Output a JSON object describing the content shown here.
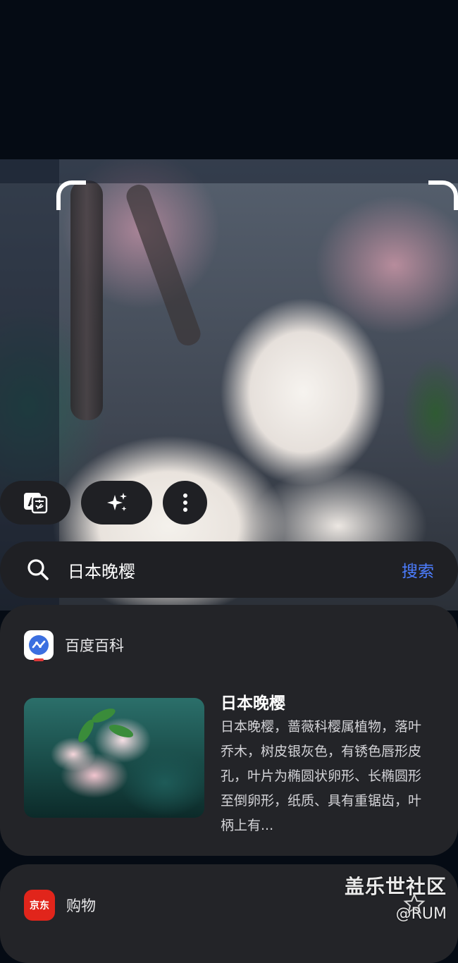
{
  "search": {
    "query": "日本晚樱",
    "action_label": "搜索"
  },
  "baike_card": {
    "source": "百度百科",
    "title": "日本晚樱",
    "description": "日本晚樱，蔷薇科樱属植物，落叶乔木，树皮银灰色，有锈色唇形皮孔，叶片为椭圆状卵形、长椭圆形至倒卵形，纸质、具有重锯齿，叶柄上有..."
  },
  "shopping_card": {
    "logo_text": "京东",
    "label": "购物"
  },
  "watermark": {
    "line1": "盖乐世社区",
    "line2": "@RUM"
  },
  "toolbar": {
    "icons": [
      "translate-icon",
      "sparkle-icon",
      "more-vertical-icon"
    ]
  },
  "colors": {
    "accent": "#4c7dff",
    "card_bg": "#232428",
    "pill_bg": "#1f2024",
    "jd_red": "#e1251b"
  }
}
